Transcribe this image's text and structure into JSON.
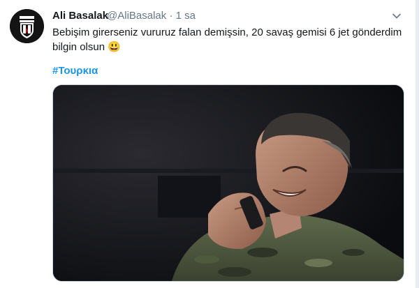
{
  "tweet": {
    "display_name": "Ali Basalak",
    "handle": "@AliBasalak",
    "separator": "·",
    "time": "1 sa",
    "text": "Bebişim girerseniz vururuz falan demişsin, 20 savaş gemisi 6 jet gönderdim bilgin olsun",
    "emoji": "😃",
    "hashtag": "#Τουρκια"
  },
  "icons": {
    "avatar": "besiktas-crest-icon",
    "menu": "chevron-down-icon"
  },
  "colors": {
    "name": "#14171a",
    "meta": "#657786",
    "link": "#1b95e0",
    "background": "#ffffff",
    "page": "#e6ecf0"
  }
}
